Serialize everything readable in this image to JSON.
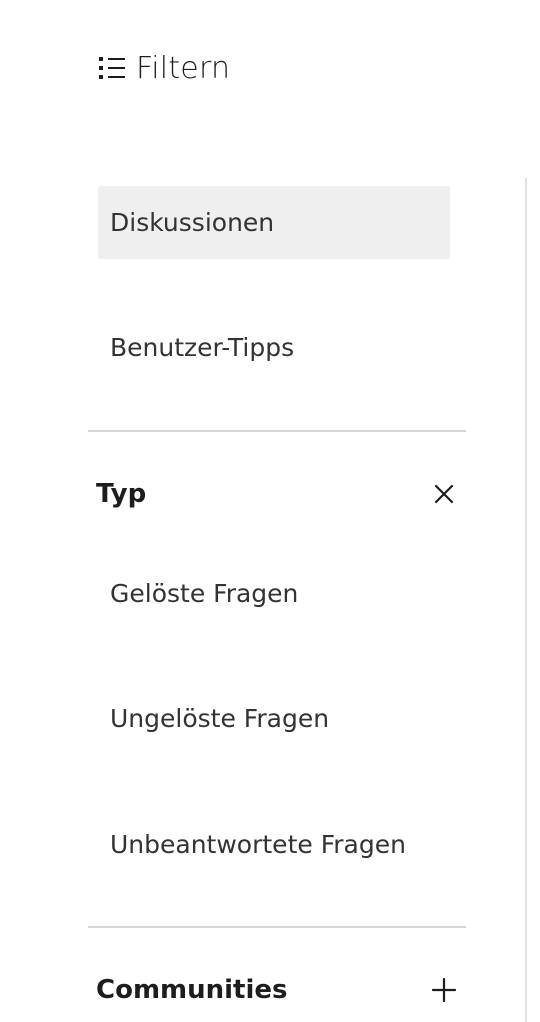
{
  "header": {
    "title": "Filtern",
    "icon": "list-icon"
  },
  "content_types": [
    {
      "label": "Diskussionen",
      "selected": true
    },
    {
      "label": "Benutzer-Tipps",
      "selected": false
    }
  ],
  "sections": {
    "typ": {
      "label": "Typ",
      "toggle_icon": "close-icon",
      "options": [
        {
          "label": "Gelöste Fragen"
        },
        {
          "label": "Ungelöste Fragen"
        },
        {
          "label": "Unbeantwortete Fragen"
        }
      ]
    },
    "communities": {
      "label": "Communities",
      "toggle_icon": "plus-icon"
    }
  },
  "colors": {
    "selected_background": "#efefef",
    "divider": "#d6d6d6",
    "text": "#333333"
  }
}
